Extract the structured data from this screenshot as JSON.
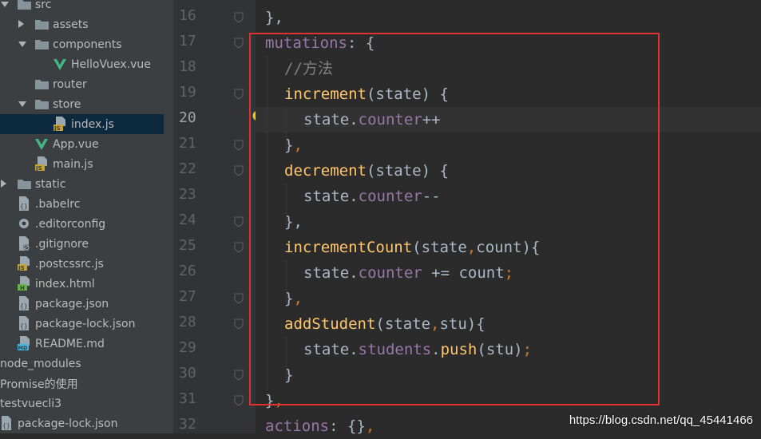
{
  "tree": {
    "items": [
      {
        "label": "src",
        "kind": "folder",
        "arrow": "down",
        "depth": 0
      },
      {
        "label": "assets",
        "kind": "folder",
        "arrow": "right",
        "depth": 1
      },
      {
        "label": "components",
        "kind": "folder",
        "arrow": "down",
        "depth": 1
      },
      {
        "label": "HelloVuex.vue",
        "kind": "vue",
        "depth": 2
      },
      {
        "label": "router",
        "kind": "folder",
        "depth": 1
      },
      {
        "label": "store",
        "kind": "folder",
        "arrow": "down",
        "depth": 1
      },
      {
        "label": "index.js",
        "kind": "js",
        "depth": 2,
        "selected": true
      },
      {
        "label": "App.vue",
        "kind": "vue",
        "depth": 1
      },
      {
        "label": "main.js",
        "kind": "js",
        "depth": 1
      },
      {
        "label": "static",
        "kind": "folder",
        "arrow": "right",
        "depth": 0
      },
      {
        "label": ".babelrc",
        "kind": "json",
        "depth": 0
      },
      {
        "label": ".editorconfig",
        "kind": "gear",
        "depth": 0
      },
      {
        "label": ".gitignore",
        "kind": "ignore",
        "depth": 0
      },
      {
        "label": ".postcssrc.js",
        "kind": "js",
        "depth": 0
      },
      {
        "label": "index.html",
        "kind": "html",
        "depth": 0
      },
      {
        "label": "package.json",
        "kind": "json",
        "depth": 0
      },
      {
        "label": "package-lock.json",
        "kind": "json",
        "depth": 0
      },
      {
        "label": "README.md",
        "kind": "md",
        "depth": 0
      },
      {
        "label": "node_modules",
        "kind": "plain",
        "depth": -1
      },
      {
        "label": "Promise的使用",
        "kind": "plain",
        "depth": -1
      },
      {
        "label": "testvuecli3",
        "kind": "plain",
        "depth": -1
      },
      {
        "label": "package-lock.json",
        "kind": "json-root",
        "depth": -1
      }
    ]
  },
  "editor": {
    "current_line": 20,
    "lines": [
      {
        "num": 16,
        "indent": 0,
        "tokens": [
          {
            "t": "},",
            "c": "k-plain"
          }
        ]
      },
      {
        "num": 17,
        "indent": 0,
        "tokens": [
          {
            "t": "mutations",
            "c": "k-prop"
          },
          {
            "t": ": {",
            "c": "k-plain"
          }
        ]
      },
      {
        "num": 18,
        "indent": 1,
        "tokens": [
          {
            "t": "//方法",
            "c": "k-comment"
          }
        ]
      },
      {
        "num": 19,
        "indent": 1,
        "tokens": [
          {
            "t": "increment",
            "c": "k-fn"
          },
          {
            "t": "(state) {",
            "c": "k-plain"
          }
        ]
      },
      {
        "num": 20,
        "indent": 2,
        "tokens": [
          {
            "t": "state.",
            "c": "k-plain"
          },
          {
            "t": "counter",
            "c": "k-prop"
          },
          {
            "t": "++",
            "c": "k-plain"
          }
        ]
      },
      {
        "num": 21,
        "indent": 1,
        "tokens": [
          {
            "t": "}",
            "c": "k-plain"
          },
          {
            "t": ",",
            "c": "k-comma"
          }
        ]
      },
      {
        "num": 22,
        "indent": 1,
        "tokens": [
          {
            "t": "decrement",
            "c": "k-fn"
          },
          {
            "t": "(state) {",
            "c": "k-plain"
          }
        ]
      },
      {
        "num": 23,
        "indent": 2,
        "tokens": [
          {
            "t": "state.",
            "c": "k-plain"
          },
          {
            "t": "counter",
            "c": "k-prop"
          },
          {
            "t": "--",
            "c": "k-plain"
          }
        ]
      },
      {
        "num": 24,
        "indent": 1,
        "tokens": [
          {
            "t": "},",
            "c": "k-plain"
          }
        ]
      },
      {
        "num": 25,
        "indent": 1,
        "tokens": [
          {
            "t": "incrementCount",
            "c": "k-fn"
          },
          {
            "t": "(state",
            "c": "k-plain"
          },
          {
            "t": ",",
            "c": "k-comma"
          },
          {
            "t": "count){",
            "c": "k-plain"
          }
        ]
      },
      {
        "num": 26,
        "indent": 2,
        "tokens": [
          {
            "t": "state.",
            "c": "k-plain"
          },
          {
            "t": "counter",
            "c": "k-prop"
          },
          {
            "t": " += count",
            "c": "k-plain"
          },
          {
            "t": ";",
            "c": "k-comma"
          }
        ]
      },
      {
        "num": 27,
        "indent": 1,
        "tokens": [
          {
            "t": "}",
            "c": "k-plain"
          },
          {
            "t": ",",
            "c": "k-comma"
          }
        ]
      },
      {
        "num": 28,
        "indent": 1,
        "tokens": [
          {
            "t": "addStudent",
            "c": "k-fn"
          },
          {
            "t": "(state",
            "c": "k-plain"
          },
          {
            "t": ",",
            "c": "k-comma"
          },
          {
            "t": "stu){",
            "c": "k-plain"
          }
        ]
      },
      {
        "num": 29,
        "indent": 2,
        "tokens": [
          {
            "t": "state.",
            "c": "k-plain"
          },
          {
            "t": "students",
            "c": "k-prop"
          },
          {
            "t": ".",
            "c": "k-plain"
          },
          {
            "t": "push",
            "c": "k-fn"
          },
          {
            "t": "(stu)",
            "c": "k-plain"
          },
          {
            "t": ";",
            "c": "k-comma"
          }
        ]
      },
      {
        "num": 30,
        "indent": 1,
        "tokens": [
          {
            "t": "}",
            "c": "k-plain"
          }
        ]
      },
      {
        "num": 31,
        "indent": 0,
        "tokens": [
          {
            "t": "}",
            "c": "k-plain"
          },
          {
            "t": ",",
            "c": "k-comma"
          }
        ]
      },
      {
        "num": 32,
        "indent": 0,
        "tokens": [
          {
            "t": "actions",
            "c": "k-prop"
          },
          {
            "t": ": {}",
            "c": "k-plain"
          },
          {
            "t": ",",
            "c": "k-comma"
          }
        ]
      }
    ],
    "fold_marker_lines": [
      16,
      17,
      19,
      21,
      22,
      24,
      25,
      27,
      28,
      30,
      31
    ]
  },
  "colors": {
    "highlight_box": "#e03131",
    "selected_row": "#0d293e",
    "vue_green": "#41b883",
    "js_badge": "#c5a332"
  },
  "icons": {
    "intention_bulb": "lightbulb-icon"
  },
  "watermark": "https://blog.csdn.net/qq_45441466"
}
